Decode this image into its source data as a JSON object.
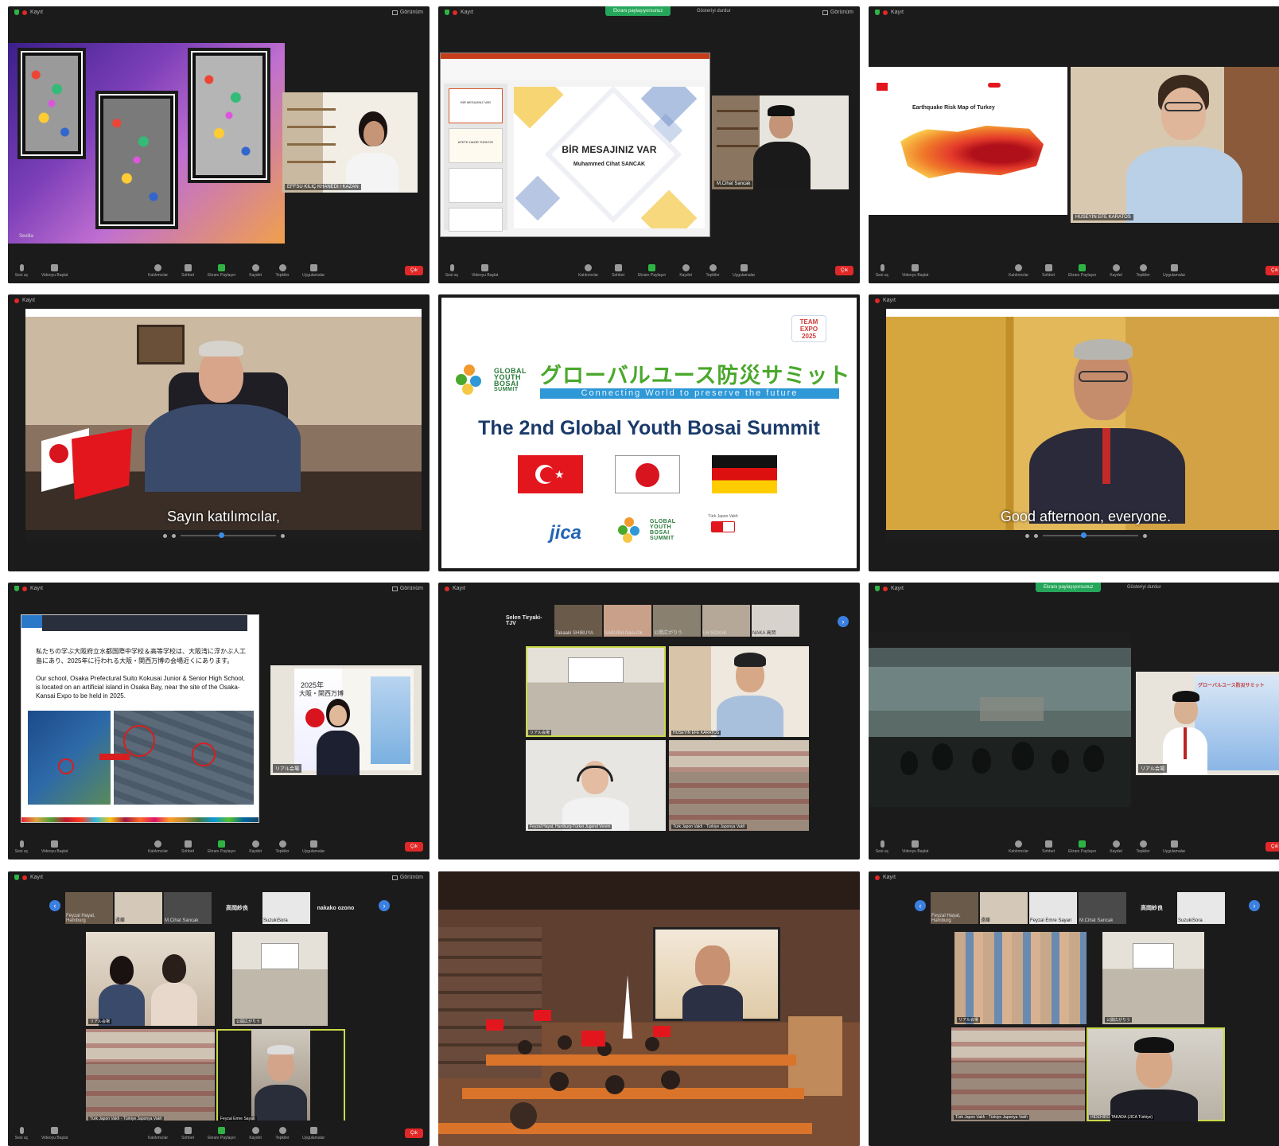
{
  "zoom": {
    "recording_label": "Kayıt",
    "view_label": "Görünüm",
    "share_banner": "Ekranı paylaşıyorsunuz",
    "stop_share": "Gösteriyi durdur",
    "controls": [
      "Sesi aç",
      "Videoyu Başlat",
      "Katılımcılar",
      "Sohbet",
      "Ekranı Paylaşın",
      "Kaydet",
      "Tepkiler",
      "Uygulamalar"
    ],
    "end_label": "Çık"
  },
  "tile1": {
    "caption": "Sevilla",
    "cam_name": "EFFSU KILIÇ KHANEDİ / KAZAN"
  },
  "tile2": {
    "ppt_title": "BİR MESAJINIZ VAR",
    "ppt_author": "Muhammed Cihat SANCAK",
    "thumb1": "BİR MESAJINIZ VAR",
    "thumb2": "AFETE HAZIR TÜRKİYE",
    "cam_name": "M.Cihat Sancak"
  },
  "tile3": {
    "map_title": "Earthquake Risk Map of Turkey",
    "cam_name": "HÜSEYİN EFE KARATOS"
  },
  "tile4": {
    "subtitle": "Sayın katılımcılar,"
  },
  "center": {
    "team_expo": "TEAM EXPO 2025",
    "logo_lines": [
      "GLOBAL",
      "YOUTH",
      "BOSAI",
      "SUMMIT"
    ],
    "jp_title": "グローバルユース防災サミット",
    "tagline": "Connecting World to preserve the future",
    "main_title": "The 2nd Global Youth Bosai Summit",
    "jica": "jica",
    "tjv": "Türk Japon Vakfı"
  },
  "tile6": {
    "subtitle": "Good afternoon, everyone."
  },
  "tile7": {
    "jp_text": "私たちの学ぶ大阪府立水都国際中学校＆高等学校は、大阪湾に浮かぶ人工島にあり、2025年に行われる大阪・関西万博の会場近くにあります。",
    "en_text": "Our school, Osaka Prefectural Suito Kokusai Junior & Senior High School, is located on an artificial island in Osaka Bay, near the site of the Osaka-Kansai Expo to be held in 2025.",
    "poster_year": "2025年",
    "poster_text": "大阪・関西万博",
    "cam_name": "リアル会場"
  },
  "tile8": {
    "speaker": "Selen Tiryaki-TJV",
    "strip_names": [
      "Selen Tiryaki-TJV",
      "Takaaki SHIBUYA",
      "SAKURA Nasi-Ok",
      "公開広がりう",
      "İ.H SOYAK",
      "NAKA 高岡"
    ],
    "cells": [
      "リアル会場",
      "HÜSEYİN EFE KARATOS",
      "Feyzal Hayat, Hamburg-Türkei Jugend Verein",
      "Türk Japon Vakfı · Türkiye Japonya Vakfı"
    ]
  },
  "tile9": {
    "poster_text": "グローバルユース防災サミット",
    "cam_name": "リアル会場"
  },
  "tile10": {
    "strip_names": [
      "Feyzal Hayat, Hamburg",
      "遠藤",
      "M.Cihat Sancak",
      "高岡紗良",
      "SuzukiSora",
      "nakako ozono"
    ],
    "name_cells": [
      "高岡紗良",
      "nakako ozono"
    ],
    "cells": [
      "リアル会場",
      "公開広がりう",
      "Türk Japon Vakfı - Türkiye Japonya Vakfı",
      "Feyzal Emre Sayan"
    ]
  },
  "tile12": {
    "strip_names": [
      "Feyzal Hayat, Hamburg",
      "遠藤",
      "Feyzal Emre Sayan",
      "M.Cihat Sancak",
      "高岡紗良",
      "SuzukiSora"
    ],
    "name_cells": [
      "高岡紗良"
    ],
    "cells": [
      "リアル会場",
      "公開広がりう",
      "Türk Japon Vakfı - Türkiye Japonya Vakfı",
      "HIDEHIRO TAKADA (JICA Türkiye)"
    ]
  }
}
